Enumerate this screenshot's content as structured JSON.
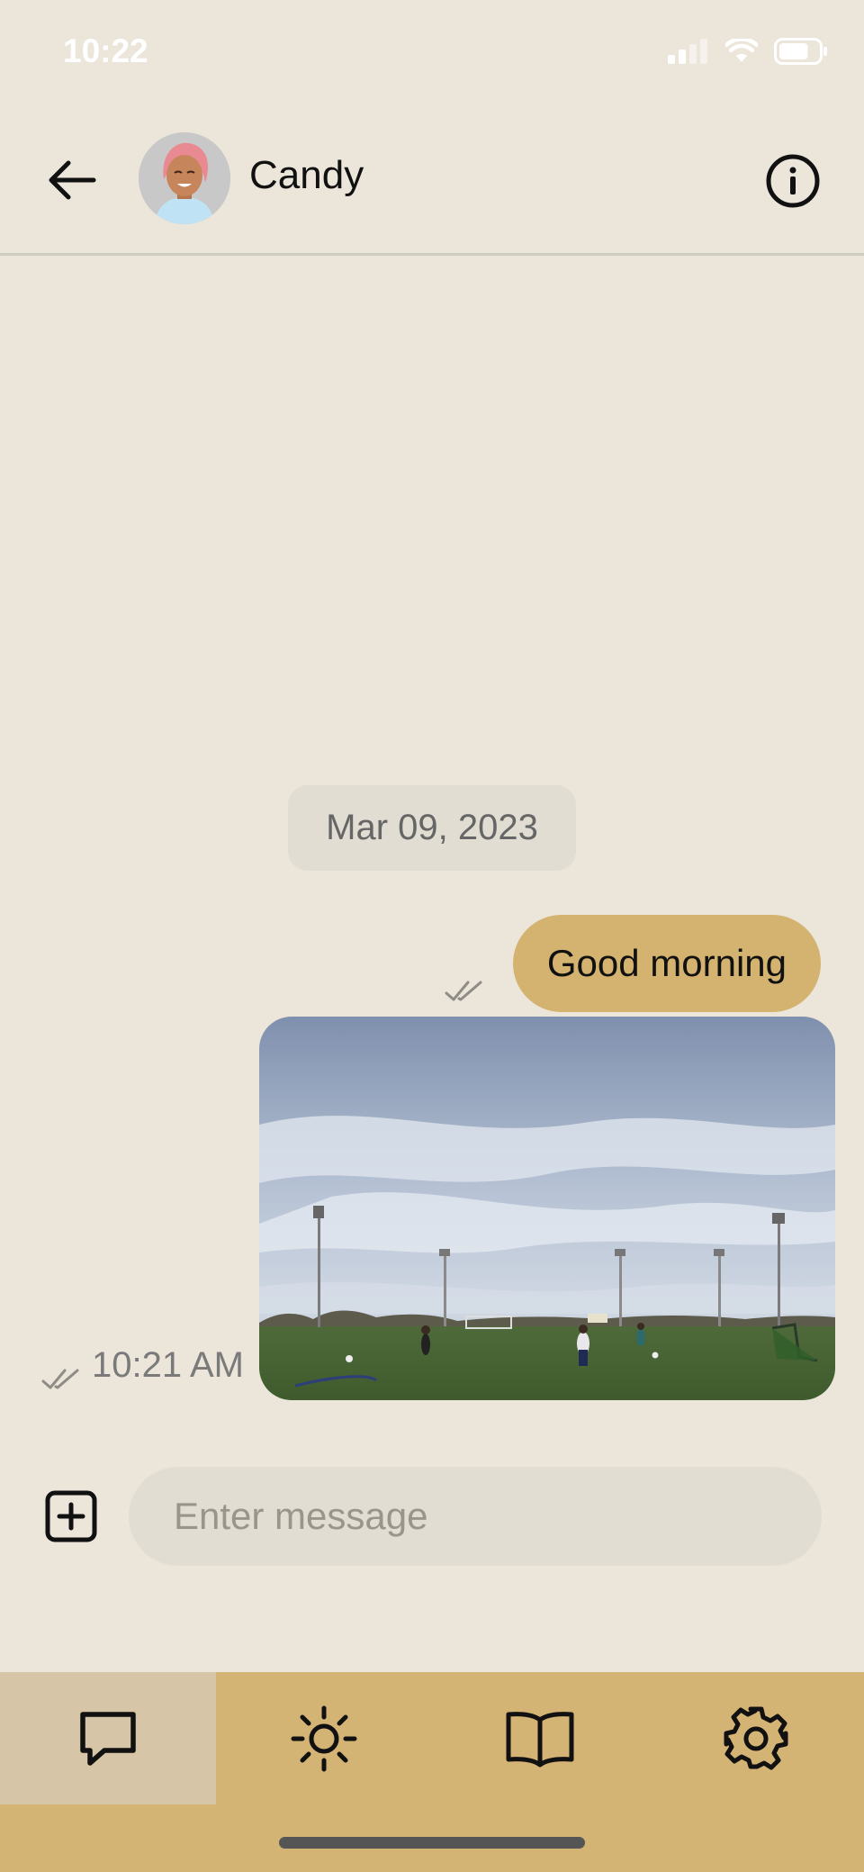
{
  "status_bar": {
    "time": "10:22",
    "battery_level": 0.75
  },
  "header": {
    "contact_name": "Candy"
  },
  "conversation": {
    "date": "Mar 09, 2023",
    "messages": [
      {
        "type": "text",
        "text": "Good morning"
      },
      {
        "type": "image",
        "time": "10:21 AM"
      }
    ]
  },
  "composer": {
    "placeholder": "Enter message"
  },
  "tabs": [
    {
      "icon": "chat-icon",
      "active": true
    },
    {
      "icon": "sun-icon",
      "active": false
    },
    {
      "icon": "book-icon",
      "active": false
    },
    {
      "icon": "gear-icon",
      "active": false
    }
  ],
  "colors": {
    "background": "#ebe5da",
    "accent": "#d4b26f",
    "tabbar": "#d4b475",
    "tab_active": "#d6c6a7"
  }
}
